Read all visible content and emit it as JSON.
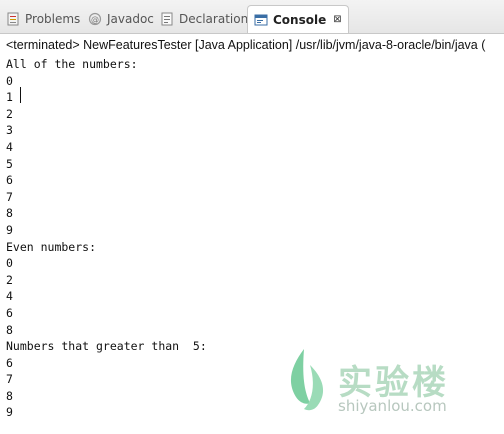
{
  "tabs": [
    {
      "label": "Problems",
      "icon": "problems-icon",
      "active": false
    },
    {
      "label": "Javadoc",
      "icon": "javadoc-icon",
      "active": false
    },
    {
      "label": "Declaration",
      "icon": "declaration-icon",
      "active": false
    },
    {
      "label": "Console",
      "icon": "console-icon",
      "active": true,
      "close": "⊠"
    }
  ],
  "header": "<terminated> NewFeaturesTester [Java Application] /usr/lib/jvm/java-8-oracle/bin/java (",
  "console_lines": [
    "All of the numbers:",
    "0",
    "1",
    "2",
    "3",
    "4",
    "5",
    "6",
    "7",
    "8",
    "9",
    "Even numbers:",
    "0",
    "2",
    "4",
    "6",
    "8",
    "Numbers that greater than  5:",
    "6",
    "7",
    "8",
    "9"
  ],
  "watermark": {
    "text": "实验楼",
    "url": "shiyanlou.com"
  },
  "colors": {
    "tab_bg": "#e6e6e6",
    "active_tab_bg": "#ffffff",
    "console_text": "#111111",
    "watermark_green": "#b7dcc4"
  }
}
